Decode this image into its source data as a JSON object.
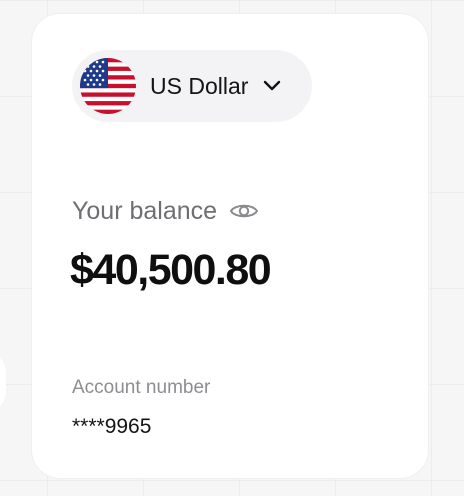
{
  "currency": {
    "flag_icon": "us-flag-icon",
    "label": "US Dollar",
    "dropdown_icon": "chevron-down-icon"
  },
  "balance": {
    "label": "Your balance",
    "visibility_icon": "eye-icon",
    "amount": "$40,500.80"
  },
  "account": {
    "label": "Account number",
    "number": "****9965"
  },
  "colors": {
    "background": "#f6f6f7",
    "card": "#ffffff",
    "selector_bg": "#f3f3f5",
    "text_primary": "#0f0f10",
    "text_secondary": "#6e6e73",
    "text_muted": "#8d8d92",
    "flag_red": "#c8102e",
    "flag_blue": "#1f3a8a"
  }
}
